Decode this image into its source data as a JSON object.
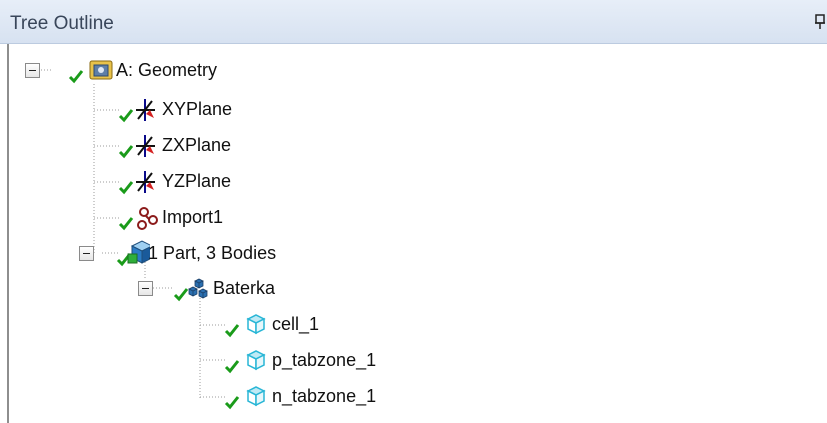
{
  "panel": {
    "title": "Tree Outline"
  },
  "tree": {
    "geometry": {
      "label": "A: Geometry",
      "expanded": true,
      "status": "check"
    },
    "planes": [
      {
        "label": "XYPlane",
        "status": "check"
      },
      {
        "label": "ZXPlane",
        "status": "check"
      },
      {
        "label": "YZPlane",
        "status": "check"
      }
    ],
    "import": {
      "label": "Import1",
      "status": "check"
    },
    "parts": {
      "label": "1 Part, 3 Bodies",
      "expanded": true,
      "status": "check"
    },
    "multibody": {
      "label": "Baterka",
      "expanded": true,
      "status": "check"
    },
    "bodies": [
      {
        "label": "cell_1",
        "status": "check"
      },
      {
        "label": "p_tabzone_1",
        "status": "check"
      },
      {
        "label": "n_tabzone_1",
        "status": "check"
      }
    ]
  },
  "colors": {
    "check": "#1a9b1a",
    "body_icon": "#29b6d6",
    "import_icon": "#8b1a1a",
    "header_text": "#39465a"
  },
  "icons": {
    "pin": "pin-icon",
    "geometry": "geometry-folder-icon",
    "plane": "plane-axis-icon",
    "import": "import-icon",
    "parts": "parts-cube-icon",
    "multibody": "multibody-part-icon",
    "body": "solid-body-icon",
    "check": "check-icon"
  }
}
